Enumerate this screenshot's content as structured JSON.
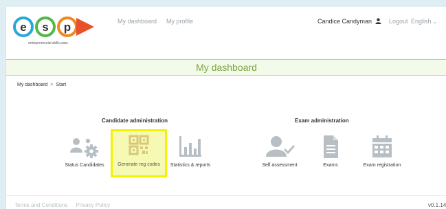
{
  "logo": {
    "letters": [
      "e",
      "s",
      "p"
    ],
    "tagline": "entrepreneurial skills pass"
  },
  "nav": {
    "items": [
      "My dashboard",
      "My profile"
    ]
  },
  "user": {
    "name": "Candice Candyman",
    "icon": "user-icon"
  },
  "header": {
    "logout": "Logout",
    "language": "English"
  },
  "page": {
    "title": "My dashboard"
  },
  "breadcrumb": {
    "items": [
      "My dashboard",
      "Start"
    ],
    "separator": ">"
  },
  "candidate_admin": {
    "heading": "Candidate administration",
    "tiles": [
      {
        "label": "Status Candidates",
        "icon": "gears-icon"
      },
      {
        "label": "Generate reg codes",
        "icon": "qr-code-icon",
        "highlighted": true
      },
      {
        "label": "Statistics & reports",
        "icon": "bar-chart-icon"
      }
    ]
  },
  "exam_admin": {
    "heading": "Exam administration",
    "tiles": [
      {
        "label": "Self assessment",
        "icon": "user-check-icon"
      },
      {
        "label": "Exams",
        "icon": "document-icon"
      },
      {
        "label": "Exam registration",
        "icon": "calendar-icon"
      }
    ]
  },
  "footer": {
    "links": [
      "Terms and Conditions",
      "Privacy Policy"
    ],
    "version": "v0.1.14"
  },
  "colors": {
    "accent_green": "#7aa33a",
    "icon_gray": "#b7bfc4",
    "highlight_yellow": "#f3f200"
  }
}
